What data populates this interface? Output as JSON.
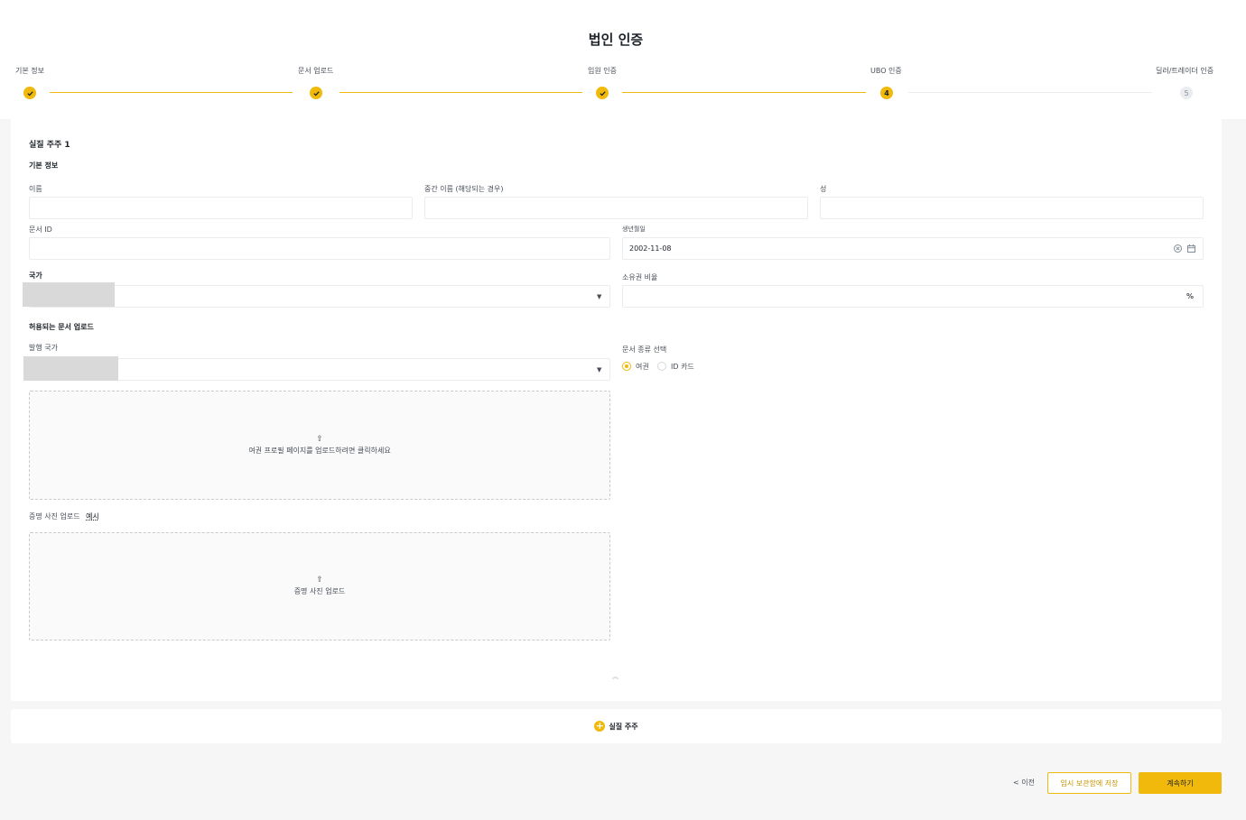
{
  "page": {
    "title": "법인 인증"
  },
  "stepper": {
    "steps": [
      {
        "label": "기본 정보",
        "status": "done",
        "marker": ""
      },
      {
        "label": "문서 업로드",
        "status": "done",
        "marker": ""
      },
      {
        "label": "임원 인증",
        "status": "done",
        "marker": ""
      },
      {
        "label": "UBO 인증",
        "status": "current",
        "marker": "4"
      },
      {
        "label": "딜러/트레이더 인증",
        "status": "todo",
        "marker": "5"
      }
    ],
    "accent_color": "#f0b90b"
  },
  "form": {
    "section_title": "실질 주주 1",
    "basic_info_title": "기본 정보",
    "first_name_label": "이름",
    "first_name_value": "",
    "middle_name_label": "중간 이름 (해당되는 경우)",
    "middle_name_value": "",
    "last_name_label": "성",
    "last_name_value": "",
    "document_id_label": "문서 ID",
    "document_id_value": "",
    "dob_label": "생년월일",
    "dob_value": "2002-11-08",
    "country_label": "국가",
    "ownership_label": "소유권 비율",
    "ownership_value": "",
    "ownership_unit": "%",
    "upload_section_title": "허용되는 문서 업로드",
    "issuing_country_label": "발행 국가",
    "doc_type_label": "문서 종류 선택",
    "doc_type_options": [
      {
        "label": "여권",
        "selected": true
      },
      {
        "label": "ID 카드",
        "selected": false
      }
    ],
    "passport_upload_text": "여권 프로필 페이지를 업로드하려면 클릭하세요",
    "proof_photo_label": "증명 사진 업로드",
    "proof_photo_example": "예시",
    "proof_upload_text": "증명 사진 업로드",
    "collapse_icon": "chevron-double-up-icon"
  },
  "add_owner": {
    "label": "실질 주주",
    "icon": "plus-circle-icon"
  },
  "footer": {
    "back_label": "< 이전",
    "save_draft_label": "임시 보관함에 저장",
    "continue_label": "계속하기"
  }
}
